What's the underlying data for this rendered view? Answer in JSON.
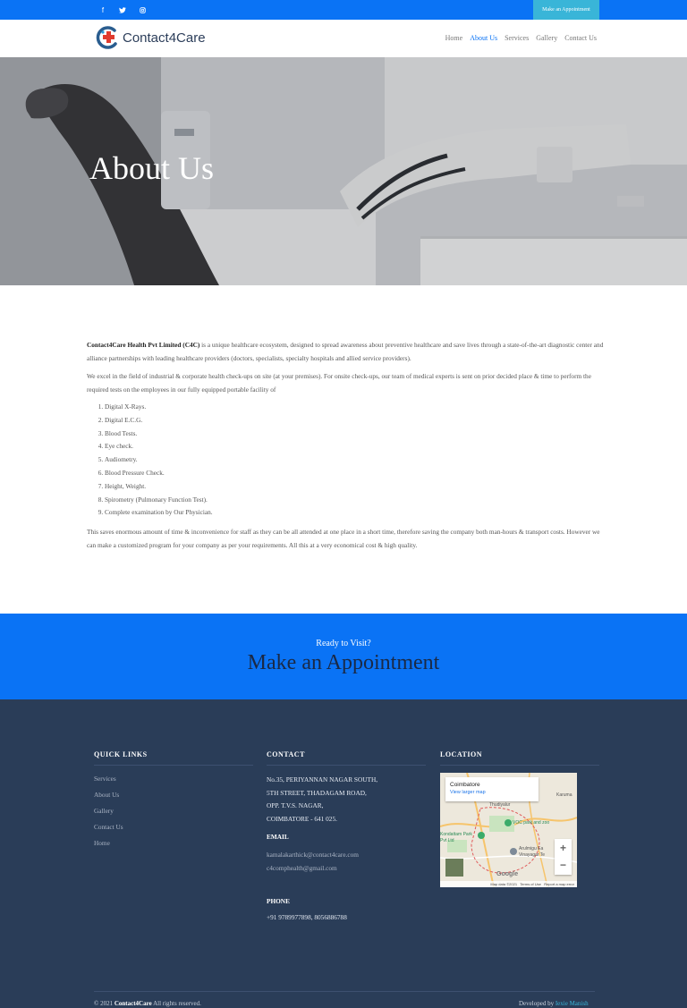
{
  "topbar": {
    "icons": [
      "facebook-icon",
      "twitter-icon",
      "instagram-icon"
    ],
    "appointment_label": "Make an Appointment"
  },
  "header": {
    "brand": "Contact4Care",
    "nav": [
      "Home",
      "About Us",
      "Services",
      "Gallery",
      "Contact Us"
    ],
    "active": "About Us"
  },
  "hero": {
    "title": "About Us"
  },
  "content": {
    "intro_bold": "Contact4Care Health Pvt Limited (C4C)",
    "intro_rest": " is a unique healthcare ecosystem, designed to spread awareness about preventive healthcare and save lives through a state-of-the-art diagnostic center and alliance partnerships with leading healthcare providers (doctors, specialists, specialty hospitals and allied service providers).",
    "para2": "We excel in the field of industrial & corporate health check-ups on site (at your premises). For onsite check-ups, our team of medical experts is sent on prior decided place & time to perform the required tests on the employees in our fully equipped portable facility of",
    "services": [
      "Digital X-Rays.",
      "Digital E.C.G.",
      "Blood Tests.",
      "Eye check.",
      "Audiometry.",
      "Blood Pressure Check.",
      "Height, Weight.",
      "Spirometry (Pulmonary Function Test).",
      "Complete examination by Our Physician."
    ],
    "para3": "This saves enormous amount of time & inconvenience for staff as they can be all attended at one place in a short time, therefore saving the company both man-hours & transport costs. However we can make a customized program for your company as per your requirements. All this at a very economical cost & high quality."
  },
  "appointment": {
    "subtitle": "Ready to Visit?",
    "title": "Make an Appointment"
  },
  "footer": {
    "quick_links_title": "QUICK LINKS",
    "quick_links": [
      "Services",
      "About Us",
      "Gallery",
      "Contact Us",
      "Home"
    ],
    "contact_title": "CONTACT",
    "address": [
      "No.35, PERIYANNAN NAGAR SOUTH,",
      "5TH STREET, THADAGAM ROAD,",
      "OPP. T.V.S. NAGAR,",
      "COIMBATORE - 641 025."
    ],
    "email_title": "EMAIL",
    "emails": [
      "kamalakarthick@contact4care.com",
      "c4comphealth@gmail.com"
    ],
    "phone_title": "PHONE",
    "phone": "+91 9789977898, 8056886788",
    "location_title": "LOCATION",
    "map": {
      "place": "Coimbatore",
      "view_larger": "View larger map",
      "labels": [
        "Thudiyalur",
        "VOC park and zoo",
        "Kondattam Park Pvt Ltd",
        "Arulmigu Ea Vinayagar Te",
        "Karuma"
      ],
      "zoom_in": "+",
      "zoom_out": "−",
      "attribution": "Map data ©2021   Terms of Use   Report a map error",
      "google": "Google"
    },
    "copyright_pre": "© 2021 ",
    "copyright_brand": "Contact4Care",
    "copyright_post": " All rights reserved.",
    "developed_pre": "Developed by ",
    "developer": "Iexie Manish"
  }
}
